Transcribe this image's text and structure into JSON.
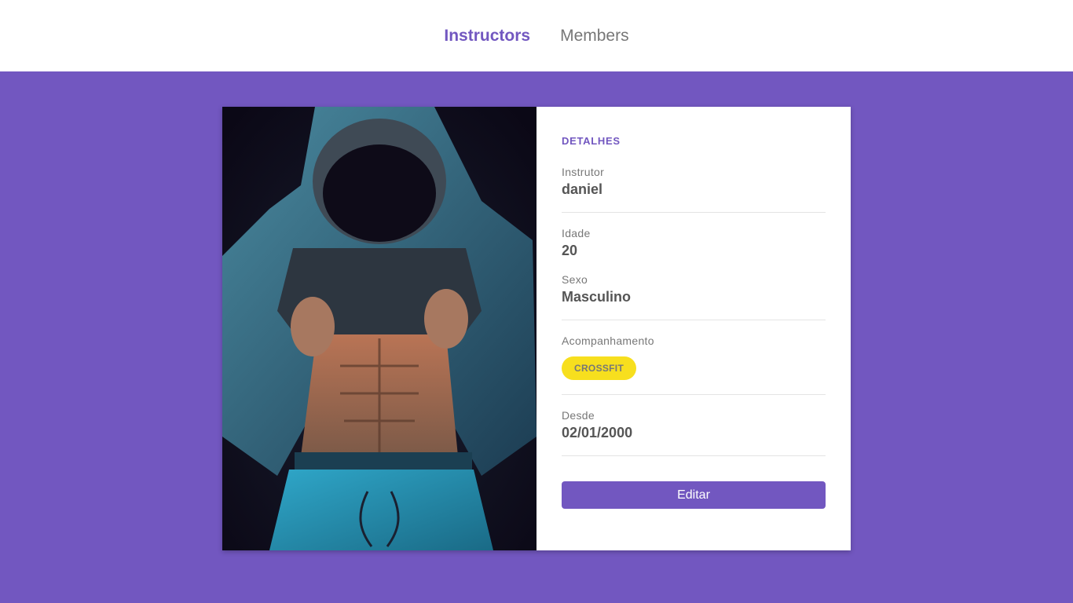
{
  "nav": {
    "items": [
      {
        "label": "Instructors",
        "active": true
      },
      {
        "label": "Members",
        "active": false
      }
    ]
  },
  "colors": {
    "accent": "#7257c0",
    "background": "#7257c0",
    "badge": "#f7df1e"
  },
  "details": {
    "heading": "DETALHES",
    "instructor_label": "Instrutor",
    "instructor_value": "daniel",
    "age_label": "Idade",
    "age_value": "20",
    "gender_label": "Sexo",
    "gender_value": "Masculino",
    "services_label": "Acompanhamento",
    "services": [
      "CROSSFIT"
    ],
    "since_label": "Desde",
    "since_value": "02/01/2000",
    "edit_label": "Editar"
  }
}
